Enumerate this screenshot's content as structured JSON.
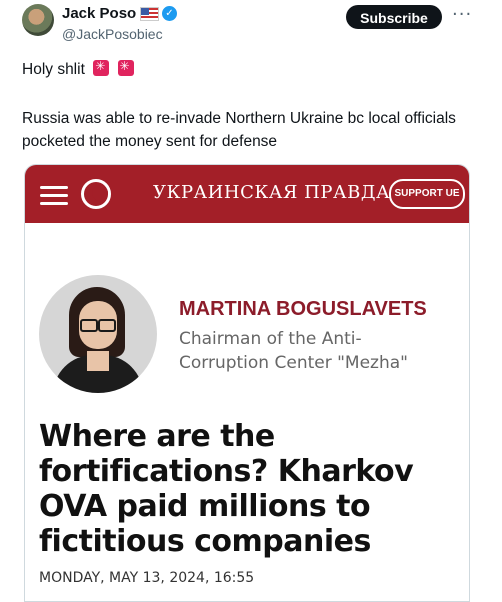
{
  "tweet": {
    "author_name": "Jack Poso",
    "handle": "@JackPosobiec",
    "subscribe_label": "Subscribe",
    "more_label": "···",
    "verified_glyph": "✓",
    "text_line1": "Holy shlit",
    "text_body": "Russia was able to re-invade Northern Ukraine bc local officials pocketed the money sent for defense"
  },
  "article": {
    "site_logo": "УКРАИНСКАЯ ПРАВДА",
    "support_label": "SUPPORT UE",
    "author_name": "MARTINA BOGUSLAVETS",
    "author_title": "Chairman of the Anti-Corruption Center \"Mezha\"",
    "headline": "Where are the fortifications? Kharkov OVA paid millions to fictitious companies",
    "date": "MONDAY, MAY 13, 2024, 16:55"
  },
  "colors": {
    "brand_red": "#a31f28",
    "author_name": "#8c1c2a",
    "twitter_blue": "#1d9bf0"
  },
  "icons": [
    "flag-us-icon",
    "verified-badge-icon",
    "siren-emoji-icon",
    "hamburger-menu-icon",
    "moon-theme-icon"
  ]
}
